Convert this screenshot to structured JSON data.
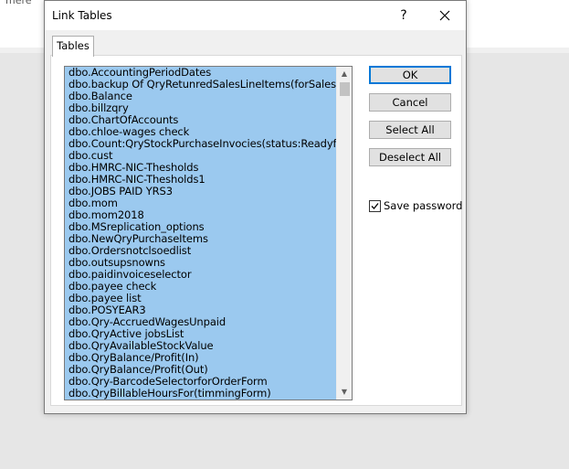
{
  "background": {
    "partial_text": "mere"
  },
  "dialog": {
    "title": "Link Tables",
    "help_label": "?",
    "close_icon": "close-icon"
  },
  "tabs": [
    {
      "label": "Tables"
    }
  ],
  "tables_list": {
    "items": [
      "dbo.AccountingPeriodDates",
      "dbo.backup Of QryRetunredSalesLineItems(forSalesRefundForm",
      "dbo.Balance",
      "dbo.billzqry",
      "dbo.ChartOfAccounts",
      "dbo.chloe-wages check",
      "dbo.Count:QryStockPurchaseInvocies(status:ReadyforPayment",
      "dbo.cust",
      "dbo.HMRC-NIC-Thesholds",
      "dbo.HMRC-NIC-Thesholds1",
      "dbo.JOBS PAID YRS3",
      "dbo.mom",
      "dbo.mom2018",
      "dbo.MSreplication_options",
      "dbo.NewQryPurchaseItems",
      "dbo.Ordersnotclsoedlist",
      "dbo.outsupsnowns",
      "dbo.paidinvoiceselector",
      "dbo.payee check",
      "dbo.payee list",
      "dbo.POSYEAR3",
      "dbo.Qry-AccruedWagesUnpaid",
      "dbo.QryActive jobsList",
      "dbo.QryAvailableStockValue",
      "dbo.QryBalance/Profit(In)",
      "dbo.QryBalance/Profit(Out)",
      "dbo.Qry-BarcodeSelectorforOrderForm",
      "dbo.QryBillableHoursFor(timmingForm)"
    ],
    "selection_color": "#9bc9ef",
    "scroll_up_icon": "chevron-up-icon",
    "scroll_down_icon": "chevron-down-icon"
  },
  "buttons": {
    "ok": "OK",
    "cancel": "Cancel",
    "select_all": "Select All",
    "deselect_all": "Deselect All"
  },
  "save_password": {
    "label": "Save password",
    "checked": true
  },
  "colors": {
    "accent": "#0078d7",
    "button_face": "#e1e1e1",
    "dialog_bg": "#f0f0f0"
  }
}
